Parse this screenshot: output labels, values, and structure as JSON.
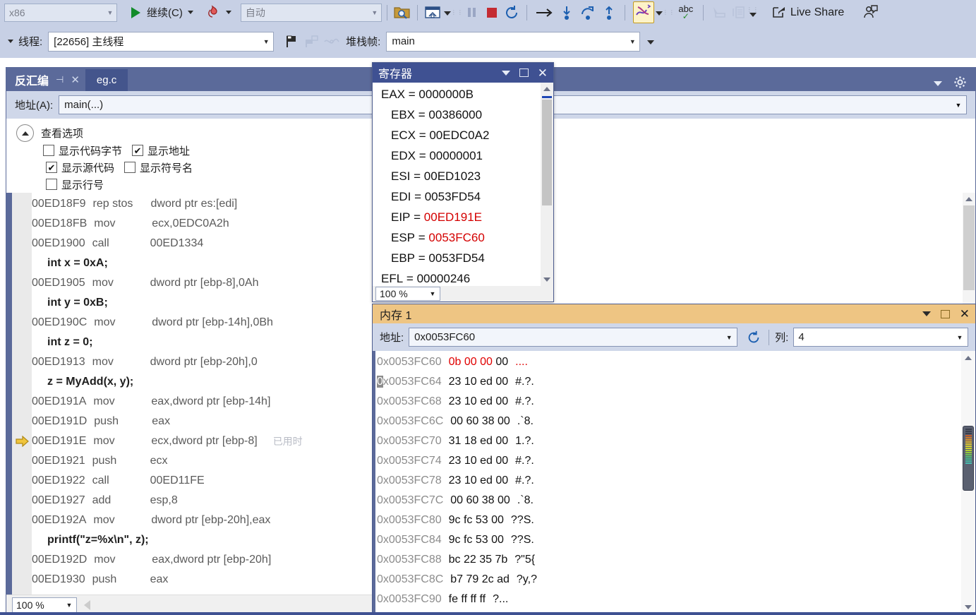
{
  "toolbar": {
    "arch": {
      "value": "x86",
      "icon": "chevron-down-icon"
    },
    "continue_label": "继续(C)",
    "continue_icon": "play-icon",
    "hot_reload_icon": "fire-icon",
    "process_value": "自动",
    "buttons": [
      {
        "name": "show-next-statement-icon",
        "glyph": "folder-search-icon"
      },
      {
        "name": "step-into-window-icon",
        "glyph": "window-home-icon"
      },
      {
        "name": "break-all-icon",
        "glyph": "pause-icon"
      },
      {
        "name": "stop-debugging-icon",
        "glyph": "stop-icon"
      },
      {
        "name": "restart-icon",
        "glyph": "restart-icon"
      },
      {
        "name": "show-next-statement-arrow-icon",
        "glyph": "arrow-right-icon"
      },
      {
        "name": "step-into-icon",
        "glyph": "step-into-icon"
      },
      {
        "name": "step-over-icon",
        "glyph": "step-over-icon"
      },
      {
        "name": "step-out-icon",
        "glyph": "step-out-icon"
      },
      {
        "name": "intellitrace-icon",
        "glyph": "threads-icon"
      },
      {
        "name": "spell-check-icon",
        "glyph": "abc-check-icon"
      },
      {
        "name": "select-tool-icon",
        "glyph": "pointer-icon"
      },
      {
        "name": "compare-icon",
        "glyph": "compare-icon"
      }
    ],
    "live_share_label": "Live Share",
    "live_share_icon": "share-icon",
    "account_icon": "account-icon"
  },
  "threadbar": {
    "thread_label": "线程:",
    "thread_value": "[22656] 主线程",
    "flag_icon": "flag-icon",
    "flags_icon": "flags-icon",
    "fish_icon": "parallel-watch-icon",
    "frame_label": "堆栈帧:",
    "frame_value": "main"
  },
  "disassembly": {
    "tab_title": "反汇编",
    "pin_icon": "pin-icon",
    "close_icon": "close-icon",
    "other_tab": "eg.c",
    "window_menu_icon": "chevron-down-icon",
    "settings_icon": "gear-icon",
    "address_label": "地址(A):",
    "address_value": "main(...)",
    "address_chevron": "chevron-down-icon",
    "view_options_title": "查看选项",
    "collapse_icon": "chevron-up-icon",
    "checkboxes": [
      {
        "label": "显示代码字节",
        "checked": false
      },
      {
        "label": "显示地址",
        "checked": true
      },
      {
        "label": "显示源代码",
        "checked": true
      },
      {
        "label": "显示符号名",
        "checked": false
      },
      {
        "label": "显示行号",
        "checked": false
      }
    ],
    "current_marker_icon": "yellow-arrow-icon",
    "elapsed_note": "已用时",
    "zoom_value": "100 %",
    "lines": [
      {
        "type": "asm",
        "addr": "00ED18F9",
        "mnemonic": "rep stos",
        "operands": "dword ptr es:[edi]",
        "current": false
      },
      {
        "type": "asm",
        "addr": "00ED18FB",
        "mnemonic": "mov",
        "operands": "ecx,0EDC0A2h",
        "current": false
      },
      {
        "type": "asm",
        "addr": "00ED1900",
        "mnemonic": "call",
        "operands": "00ED1334",
        "current": false
      },
      {
        "type": "src",
        "text": "int x = 0xA;"
      },
      {
        "type": "asm",
        "addr": "00ED1905",
        "mnemonic": "mov",
        "operands": "dword ptr [ebp-8],0Ah",
        "current": false
      },
      {
        "type": "src",
        "text": "int y = 0xB;"
      },
      {
        "type": "asm",
        "addr": "00ED190C",
        "mnemonic": "mov",
        "operands": "dword ptr [ebp-14h],0Bh",
        "current": false
      },
      {
        "type": "src",
        "text": "int z = 0;"
      },
      {
        "type": "asm",
        "addr": "00ED1913",
        "mnemonic": "mov",
        "operands": "dword ptr [ebp-20h],0",
        "current": false
      },
      {
        "type": "src",
        "text": "z = MyAdd(x, y);"
      },
      {
        "type": "asm",
        "addr": "00ED191A",
        "mnemonic": "mov",
        "operands": "eax,dword ptr [ebp-14h]",
        "current": false
      },
      {
        "type": "asm",
        "addr": "00ED191D",
        "mnemonic": "push",
        "operands": "eax",
        "current": false
      },
      {
        "type": "asm",
        "addr": "00ED191E",
        "mnemonic": "mov",
        "operands": "ecx,dword ptr [ebp-8]",
        "current": true,
        "note": "已用时"
      },
      {
        "type": "asm",
        "addr": "00ED1921",
        "mnemonic": "push",
        "operands": "ecx",
        "current": false
      },
      {
        "type": "asm",
        "addr": "00ED1922",
        "mnemonic": "call",
        "operands": "00ED11FE",
        "current": false
      },
      {
        "type": "asm",
        "addr": "00ED1927",
        "mnemonic": "add",
        "operands": "esp,8",
        "current": false
      },
      {
        "type": "asm",
        "addr": "00ED192A",
        "mnemonic": "mov",
        "operands": "dword ptr [ebp-20h],eax",
        "current": false
      },
      {
        "type": "src",
        "text": "printf(\"z=%x\\n\", z);"
      },
      {
        "type": "asm",
        "addr": "00ED192D",
        "mnemonic": "mov",
        "operands": "eax,dword ptr [ebp-20h]",
        "current": false
      },
      {
        "type": "asm",
        "addr": "00ED1930",
        "mnemonic": "push",
        "operands": "eax",
        "current": false
      }
    ]
  },
  "registers": {
    "title": "寄存器",
    "menu_icon": "chevron-down-icon",
    "maximize_icon": "maximize-icon",
    "close_icon": "close-icon",
    "zoom_value": "100 %",
    "rows": [
      {
        "name": "EAX",
        "value": "0000000B",
        "highlight": false,
        "indent": 0
      },
      {
        "name": "EBX",
        "value": "00386000",
        "highlight": false,
        "indent": 1
      },
      {
        "name": "ECX",
        "value": "00EDC0A2",
        "highlight": false,
        "indent": 1
      },
      {
        "name": "EDX",
        "value": "00000001",
        "highlight": false,
        "indent": 1
      },
      {
        "name": "ESI",
        "value": "00ED1023",
        "highlight": false,
        "indent": 1
      },
      {
        "name": "EDI",
        "value": "0053FD54",
        "highlight": false,
        "indent": 1
      },
      {
        "name": "EIP",
        "value": "00ED191E",
        "highlight": true,
        "indent": 1
      },
      {
        "name": "ESP",
        "value": "0053FC60",
        "highlight": true,
        "indent": 1
      },
      {
        "name": "EBP",
        "value": "0053FD54",
        "highlight": false,
        "indent": 1
      },
      {
        "name": "EFL",
        "value": "00000246",
        "highlight": false,
        "indent": 0
      }
    ]
  },
  "memory": {
    "title": "内存 1",
    "menu_icon": "chevron-down-icon",
    "maximize_icon": "maximize-icon",
    "close_icon": "close-icon",
    "address_label": "地址:",
    "address_value": "0x0053FC60",
    "address_chevron": "chevron-down-icon",
    "refresh_icon": "refresh-icon",
    "columns_label": "列:",
    "columns_value": "4",
    "columns_chevron": "chevron-down-icon",
    "rows": [
      {
        "addr": "0x0053FC60",
        "hex": "0b 00 00 00",
        "hex_hot": "0b 00 00",
        "hex_rest": " 00",
        "ascii": "....",
        "ascii_hot": true
      },
      {
        "addr": "0x0053FC64",
        "hex": "23 10 ed 00",
        "ascii": "#.?.",
        "cursor": true
      },
      {
        "addr": "0x0053FC68",
        "hex": "23 10 ed 00",
        "ascii": "#.?."
      },
      {
        "addr": "0x0053FC6C",
        "hex": "00 60 38 00",
        "ascii": ".`8."
      },
      {
        "addr": "0x0053FC70",
        "hex": "31 18 ed 00",
        "ascii": "1.?."
      },
      {
        "addr": "0x0053FC74",
        "hex": "23 10 ed 00",
        "ascii": "#.?."
      },
      {
        "addr": "0x0053FC78",
        "hex": "23 10 ed 00",
        "ascii": "#.?."
      },
      {
        "addr": "0x0053FC7C",
        "hex": "00 60 38 00",
        "ascii": ".`8."
      },
      {
        "addr": "0x0053FC80",
        "hex": "9c fc 53 00",
        "ascii": "??S."
      },
      {
        "addr": "0x0053FC84",
        "hex": "9c fc 53 00",
        "ascii": "??S."
      },
      {
        "addr": "0x0053FC88",
        "hex": "bc 22 35 7b",
        "ascii": "?\"5{"
      },
      {
        "addr": "0x0053FC8C",
        "hex": "b7 79 2c ad",
        "ascii": "?y,?"
      },
      {
        "addr": "0x0053FC90",
        "hex": "fe ff ff ff",
        "ascii": "?..."
      }
    ]
  },
  "colors": {
    "toolbar_bg": "#c7d0e5",
    "disasm_header": "#5b6a9a",
    "registers_header": "#3f5192",
    "memory_header": "#eec583",
    "highlight_red": "#d40000",
    "address_gray": "#8c8c8c",
    "current_arrow": "#f0c53c"
  }
}
